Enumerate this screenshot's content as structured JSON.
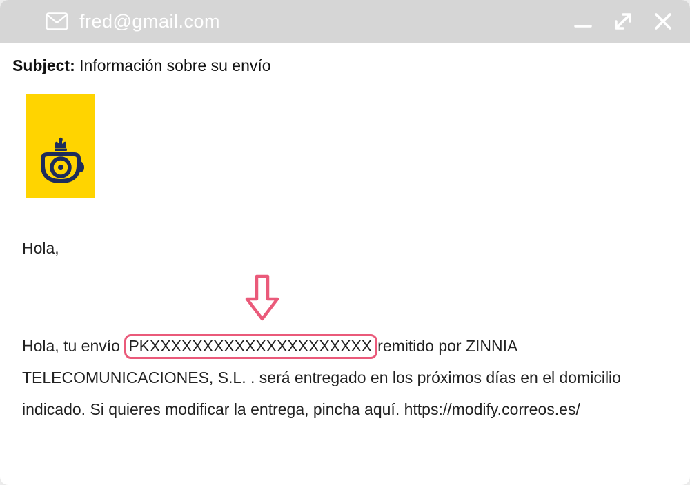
{
  "header": {
    "from": "fred@gmail.com"
  },
  "subject": {
    "label": "Subject:",
    "text": "Información sobre su envío"
  },
  "body": {
    "greeting": "Hola,",
    "pre": "Hola, tu envío",
    "tracking": "PKXXXXXXXXXXXXXXXXXXXXX",
    "post": "remitido por ZINNIA TELECOMUNICACIONES, S.L. . será entregado en los próximos días en el domicilio indicado. Si quieres modificar la entrega, pincha aquí. https://modify.correos.es/"
  },
  "colors": {
    "accent_highlight": "#ea5a7a",
    "brand_yellow": "#ffd400",
    "brand_navy": "#1d2c5b"
  }
}
